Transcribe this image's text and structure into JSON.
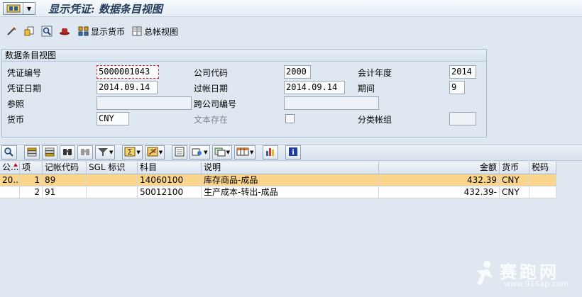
{
  "window": {
    "title": "显示凭证: 数据条目视图"
  },
  "toolbar": {
    "display_currency_label": "显示货币",
    "general_ledger_view_label": "总帐视图"
  },
  "header_group": {
    "title": "数据条目视图",
    "doc_number": {
      "label": "凭证编号",
      "value": "5000001043"
    },
    "company_code": {
      "label": "公司代码",
      "value": "2000"
    },
    "fiscal_year": {
      "label": "会计年度",
      "value": "2014"
    },
    "doc_date": {
      "label": "凭证日期",
      "value": "2014.09.14"
    },
    "posting_date": {
      "label": "过帐日期",
      "value": "2014.09.14"
    },
    "period": {
      "label": "期间",
      "value": "9"
    },
    "reference": {
      "label": "参照",
      "value": ""
    },
    "cross_company": {
      "label": "跨公司编号",
      "value": ""
    },
    "currency": {
      "label": "货币",
      "value": "CNY"
    },
    "text_exists": {
      "label": "文本存在",
      "checked": false
    },
    "ledger_group": {
      "label": "分类帐组",
      "value": ""
    }
  },
  "table": {
    "columns": [
      "公...",
      "项",
      "记帐代码",
      "SGL 标识",
      "科目",
      "说明",
      "金额",
      "货币",
      "税码"
    ],
    "rows": [
      {
        "company": "20...",
        "item": "1",
        "posting_key": "89",
        "sgl": "",
        "account": "14060100",
        "description": "库存商品-成品",
        "amount": "432.39",
        "currency": "CNY",
        "tax": ""
      },
      {
        "company": "",
        "item": "2",
        "posting_key": "91",
        "sgl": "",
        "account": "50012100",
        "description": "生产成本-转出-成品",
        "amount": "432.39-",
        "currency": "CNY",
        "tax": ""
      }
    ]
  },
  "watermark": {
    "name": "赛跑网",
    "url": "www.91Sap.com"
  },
  "colors": {
    "selected_row": "#fbd58c",
    "title_text": "#243d5a",
    "background": "#dfe8f1"
  }
}
